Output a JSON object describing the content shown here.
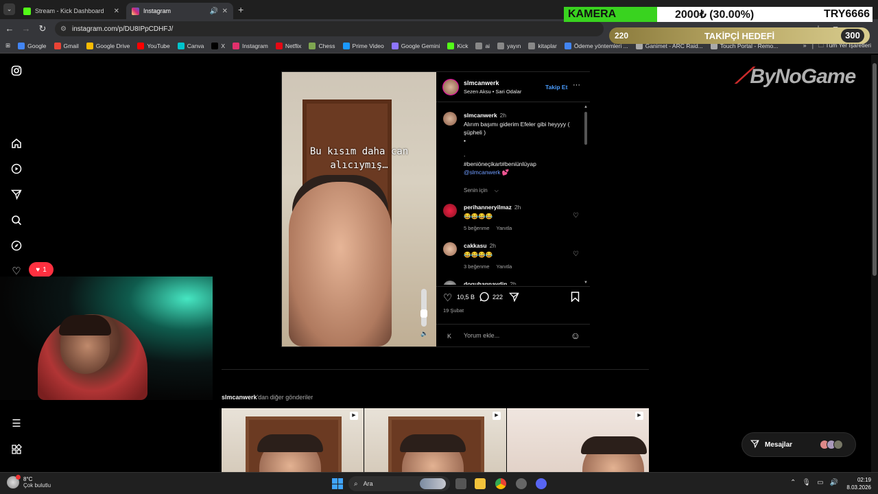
{
  "browser": {
    "tabs": [
      {
        "label": "Stream - Kick Dashboard",
        "active": false,
        "favicon_color": "#53fc18"
      },
      {
        "label": "Instagram",
        "active": true,
        "favicon_color": "#e1306c"
      }
    ],
    "url": "instagram.com/p/DU8IPpCDHFJ/",
    "bookmarks": [
      {
        "label": "Google",
        "color": "#4285f4"
      },
      {
        "label": "Gmail",
        "color": "#ea4335"
      },
      {
        "label": "Google Drive",
        "color": "#fbbc04"
      },
      {
        "label": "YouTube",
        "color": "#ff0000"
      },
      {
        "label": "Canva",
        "color": "#00c4cc"
      },
      {
        "label": "X",
        "color": "#000000"
      },
      {
        "label": "Instagram",
        "color": "#e1306c"
      },
      {
        "label": "Netflix",
        "color": "#e50914"
      },
      {
        "label": "Chess",
        "color": "#7fa650"
      },
      {
        "label": "Prime Video",
        "color": "#1a98ff"
      },
      {
        "label": "Google Gemini",
        "color": "#8e75ff"
      },
      {
        "label": "Kick",
        "color": "#53fc18"
      },
      {
        "label": "ai",
        "color": "#888888"
      },
      {
        "label": "yayın",
        "color": "#888888"
      },
      {
        "label": "kitaplar",
        "color": "#888888"
      },
      {
        "label": "Ödeme yöntemleri ...",
        "color": "#4285f4"
      },
      {
        "label": "Ganimet - ARC Raid...",
        "color": "#aaaaaa"
      },
      {
        "label": "Touch Portal - Remo...",
        "color": "#aaaaaa"
      }
    ],
    "bookmarks_more": "»",
    "all_bookmarks": "Tüm Yer İşaretleri"
  },
  "overlay": {
    "camera_label": "KAMERA",
    "camera_price": "2000₺ (30.00%)",
    "currency_total": "TRY6666",
    "goal_current": "220",
    "goal_title": "TAKİPÇİ HEDEFİ",
    "goal_target": "300"
  },
  "instagram": {
    "notification_count": "1",
    "post": {
      "video_caption": "Bu kısım daha can alıcıymış…",
      "username": "slmcanwerk",
      "song": "Sezen Aksu • Sari Odalar",
      "follow_label": "Takip Et",
      "more_label": "···",
      "caption": {
        "user": "slmcanwerk",
        "time": "2h",
        "text": "Alırım başımı giderim Efeler gibi heyyyy ( şüpheli )",
        "dot1": "•",
        "dot2": ".",
        "hashtags": "#beniöneçikart#beniünlüyap",
        "mention": "@slmcanwerk",
        "heart": "💕"
      },
      "for_you": "Senin için",
      "comments": [
        {
          "user": "perihanneryilmaz",
          "time": "2h",
          "text": "😂😂😂😂",
          "likes": "5 beğenme",
          "reply": "Yanıtla"
        },
        {
          "user": "cakkasu",
          "time": "2h",
          "text": "😂😂😂😂",
          "likes": "3 beğenme",
          "reply": "Yanıtla"
        },
        {
          "user": "doguhannaydin",
          "time": "2h",
          "text": "",
          "likes": "",
          "reply": ""
        }
      ],
      "like_count": "10,5 B",
      "comment_count": "222",
      "date": "19 Şubat",
      "comment_placeholder": "Yorum ekle..."
    },
    "more_posts_user": "slmcanwerk",
    "more_posts_suffix": "'dan diğer gönderiler",
    "messages_label": "Mesajlar"
  },
  "logo_text": "ByNoGame",
  "taskbar": {
    "temp": "8°C",
    "weather": "Çok bulutlu",
    "search_label": "Ara",
    "time": "02:19",
    "date": "8.03.2026"
  }
}
